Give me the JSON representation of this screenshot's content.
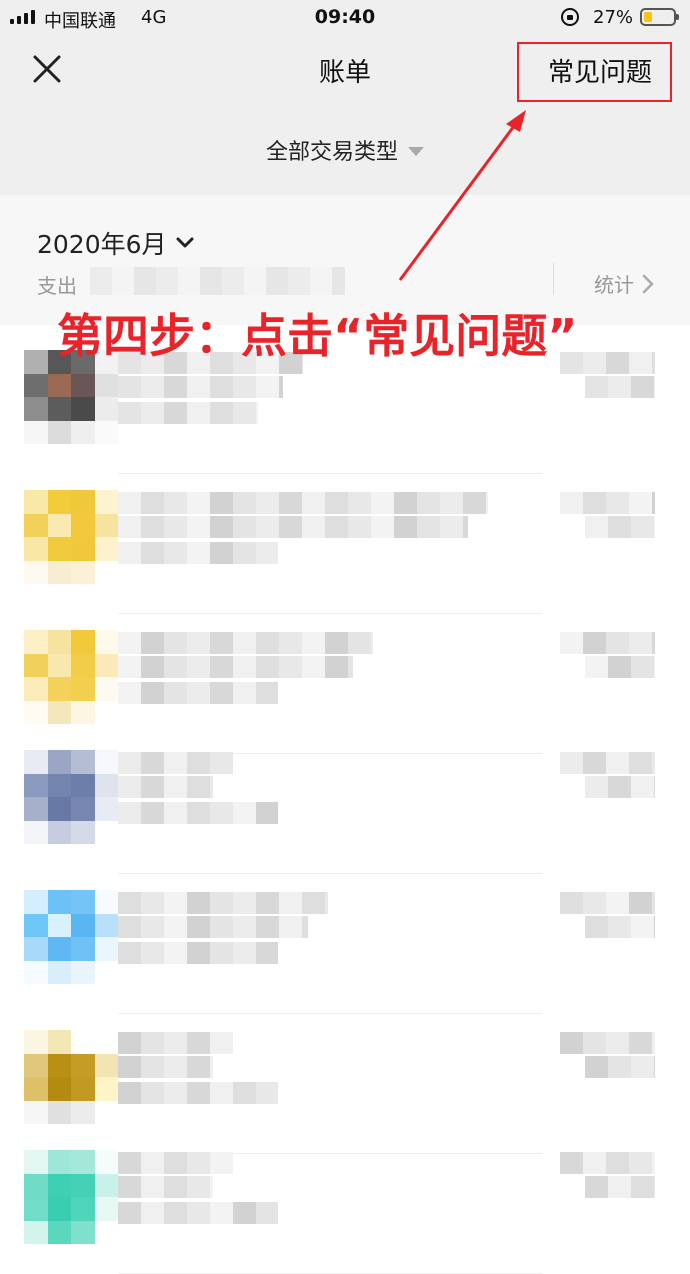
{
  "status_bar": {
    "carrier": "中国联通",
    "network": "4G",
    "time": "09:40",
    "battery_percent": "27%",
    "battery_level": 0.27,
    "icons": [
      "signal-icon",
      "rotation-lock-icon",
      "battery-icon"
    ]
  },
  "nav": {
    "close_icon": "close-icon",
    "title": "账单",
    "faq_label": "常见问题"
  },
  "filter": {
    "label": "全部交易类型",
    "icon": "caret-down-icon"
  },
  "summary": {
    "month": "2020年6月",
    "spend_label": "支出",
    "stats_label": "统计"
  },
  "annotation": {
    "text": "第四步：点击“常见问题”",
    "color": "#e8242a"
  },
  "colors": {
    "header_bg": "#efefef",
    "summary_bg": "#f7f7f7",
    "highlight": "#e8242a",
    "battery": "#f5c518"
  },
  "transactions": [
    {
      "avatar_colors": [
        "#b0b0b0",
        "#575757",
        "#6a6a6a",
        "#f2f2f2",
        "#6e6e6e",
        "#9a6a55",
        "#6a5656",
        "#e0e0e0",
        "#8d8d8d",
        "#5c5c5c",
        "#4a4a4a",
        "#ececec",
        "#f6f6f6",
        "#dcdcdc",
        "#efefef",
        "#fafafa"
      ]
    },
    {
      "avatar_colors": [
        "#f8e9a8",
        "#f2cc3a",
        "#f0c93a",
        "#fdf3cf",
        "#f1d159",
        "#fbeab0",
        "#f1c93a",
        "#f7e3a0",
        "#f9e7a6",
        "#f1cb3c",
        "#f0c83a",
        "#fdf2cc",
        "#fffaf0",
        "#f7edd1",
        "#fbf1d6",
        "#ffffff"
      ]
    },
    {
      "avatar_colors": [
        "#fdf0c7",
        "#f7e3a0",
        "#f1c93a",
        "#fff9ea",
        "#f1d15c",
        "#f9e8ae",
        "#f2cd48",
        "#f9eab8",
        "#fbecb9",
        "#f3d15a",
        "#f2cf4c",
        "#fffaf0",
        "#fefbf3",
        "#f5e7bc",
        "#fdf6e3",
        "#ffffff"
      ]
    },
    {
      "avatar_colors": [
        "#e8ebf3",
        "#9aa6c3",
        "#b4bdd3",
        "#f7f8fb",
        "#8b9abf",
        "#7384ae",
        "#6c7eaa",
        "#dfe3ee",
        "#a5b0cb",
        "#6979a6",
        "#7787b1",
        "#e8ebf3",
        "#f3f5f9",
        "#c6cde0",
        "#d5dae8",
        "#ffffff"
      ]
    },
    {
      "avatar_colors": [
        "#d5eefd",
        "#6cc1f6",
        "#74c4f7",
        "#f5fbff",
        "#6fc6f8",
        "#d9f1ff",
        "#5ab5f3",
        "#b9dffb",
        "#a8d8fa",
        "#5fb8f4",
        "#70c1f6",
        "#eaf6fe",
        "#f4faff",
        "#d8eefd",
        "#e9f5fe",
        "#ffffff"
      ]
    },
    {
      "avatar_colors": [
        "#fbf6e2",
        "#f4e7b6",
        "#ffffff",
        "#ffffff",
        "#e0c77c",
        "#b98f14",
        "#c59c26",
        "#f3e5b3",
        "#dfc06a",
        "#b58a10",
        "#c29a22",
        "#fff4c8",
        "#f6f6f6",
        "#e0e0e0",
        "#ececec",
        "#ffffff"
      ]
    },
    {
      "avatar_colors": [
        "#e2f7f2",
        "#9ee6d7",
        "#a4e8da",
        "#f5fdfb",
        "#6fdcc6",
        "#3fd0b4",
        "#44d1b5",
        "#c8f2e9",
        "#72ddc7",
        "#39ceb1",
        "#4fd5bb",
        "#e6f9f5",
        "#d2f4ed",
        "#5ad7be",
        "#7fe0cc",
        "#ffffff"
      ]
    }
  ]
}
